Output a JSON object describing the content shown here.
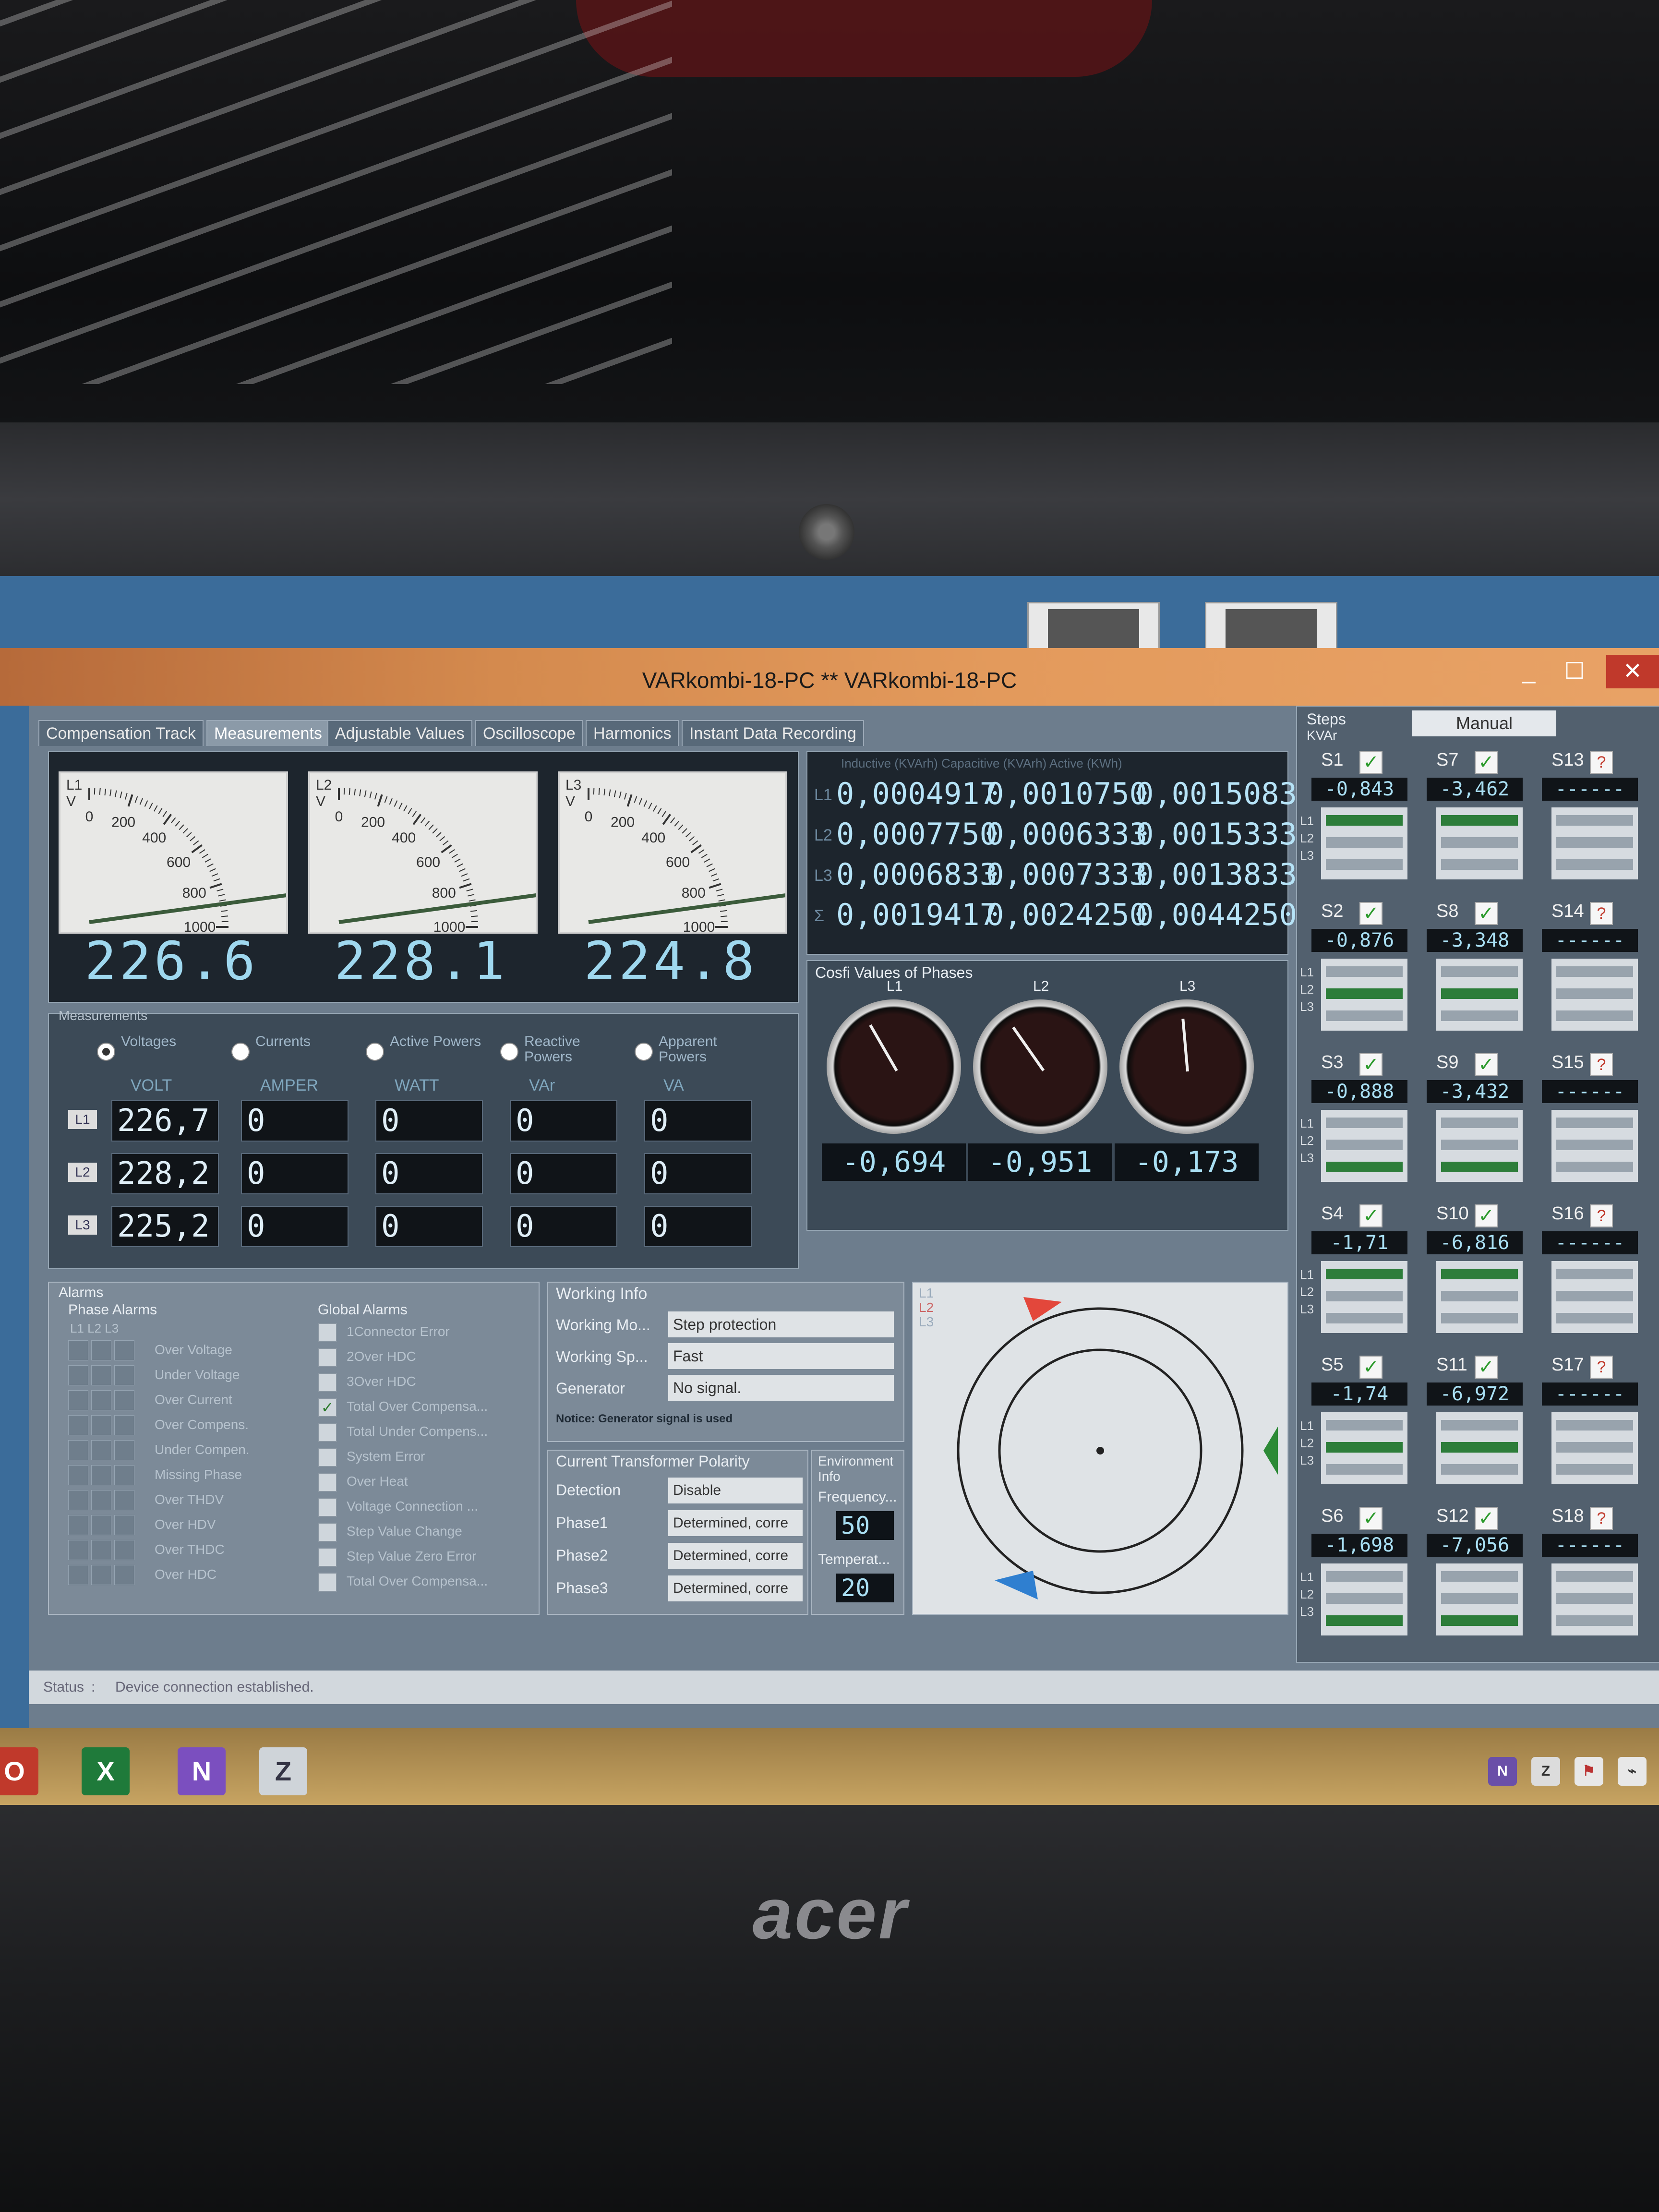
{
  "window": {
    "title": "VARkombi-18-PC ** VARkombi-18-PC",
    "minimize": "_",
    "maximize": "☐",
    "close": "✕"
  },
  "tabs": [
    {
      "label": "Compensation Track"
    },
    {
      "label": "Measurements"
    },
    {
      "label": "Adjustable Values"
    },
    {
      "label": "Oscilloscope"
    },
    {
      "label": "Harmonics"
    },
    {
      "label": "Instant Data Recording"
    }
  ],
  "meters": [
    {
      "phase": "L1",
      "unit": "V",
      "reading": "226.6",
      "ticks": [
        "0",
        "200",
        "400",
        "600",
        "800",
        "1000"
      ]
    },
    {
      "phase": "L2",
      "unit": "V",
      "reading": "228.1",
      "ticks": [
        "0",
        "200",
        "400",
        "600",
        "800",
        "1000"
      ]
    },
    {
      "phase": "L3",
      "unit": "V",
      "reading": "224.8",
      "ticks": [
        "0",
        "200",
        "400",
        "600",
        "800",
        "1000"
      ]
    }
  ],
  "matrix": {
    "header": "Inductive  (KVArh)  Capacitive  (KVArh)  Active (KWh)",
    "row_labels": [
      "L1",
      "L2",
      "L3",
      "Σ"
    ],
    "rows": [
      [
        "0,0004917",
        "0,0010750",
        "0,0015083"
      ],
      [
        "0,0007750",
        "0,0006333",
        "0,0015333"
      ],
      [
        "0,0006833",
        "0,0007333",
        "0,0013833"
      ],
      [
        "0,0019417",
        "0,0024250",
        "0,0044250"
      ]
    ]
  },
  "measurements": {
    "group_label": "Measurements",
    "options": [
      {
        "label": "Voltages",
        "selected": true
      },
      {
        "label": "Currents",
        "selected": false
      },
      {
        "label": "Active Powers",
        "selected": false
      },
      {
        "label": "Reactive Powers",
        "selected": false
      },
      {
        "label": "Apparent Powers",
        "selected": false
      }
    ],
    "columns": [
      "VOLT",
      "AMPER",
      "WATT",
      "VAr",
      "VA"
    ],
    "rows": [
      {
        "label": "L1",
        "values": [
          "226,7",
          "0",
          "0",
          "0",
          "0"
        ]
      },
      {
        "label": "L2",
        "values": [
          "228,2",
          "0",
          "0",
          "0",
          "0"
        ]
      },
      {
        "label": "L3",
        "values": [
          "225,2",
          "0",
          "0",
          "0",
          "0"
        ]
      }
    ]
  },
  "cosfi": {
    "title": "Cosfi Values of Phases",
    "phases": [
      {
        "label": "L1",
        "value": "-0,694"
      },
      {
        "label": "L2",
        "value": "-0,951"
      },
      {
        "label": "L3",
        "value": "-0,173"
      }
    ]
  },
  "steps": {
    "title": "Steps",
    "unit": "KVAr",
    "mode": "Manual",
    "phase_labels": [
      "L1",
      "L2",
      "L3"
    ],
    "cards": [
      {
        "name": "S1",
        "value": "-0,843",
        "checked": true,
        "bars": [
          1,
          0,
          0
        ]
      },
      {
        "name": "S7",
        "value": "-3,462",
        "checked": true,
        "bars": [
          1,
          0,
          0
        ]
      },
      {
        "name": "S13",
        "value": "------",
        "checked": false,
        "bars": [
          0,
          0,
          0
        ]
      },
      {
        "name": "S2",
        "value": "-0,876",
        "checked": true,
        "bars": [
          0,
          1,
          0
        ]
      },
      {
        "name": "S8",
        "value": "-3,348",
        "checked": true,
        "bars": [
          0,
          1,
          0
        ]
      },
      {
        "name": "S14",
        "value": "------",
        "checked": false,
        "bars": [
          0,
          0,
          0
        ]
      },
      {
        "name": "S3",
        "value": "-0,888",
        "checked": true,
        "bars": [
          0,
          0,
          1
        ]
      },
      {
        "name": "S9",
        "value": "-3,432",
        "checked": true,
        "bars": [
          0,
          0,
          1
        ]
      },
      {
        "name": "S15",
        "value": "------",
        "checked": false,
        "bars": [
          0,
          0,
          0
        ]
      },
      {
        "name": "S4",
        "value": "-1,71",
        "checked": true,
        "bars": [
          1,
          0,
          0
        ]
      },
      {
        "name": "S10",
        "value": "-6,816",
        "checked": true,
        "bars": [
          1,
          0,
          0
        ]
      },
      {
        "name": "S16",
        "value": "------",
        "checked": false,
        "bars": [
          0,
          0,
          0
        ]
      },
      {
        "name": "S5",
        "value": "-1,74",
        "checked": true,
        "bars": [
          0,
          1,
          0
        ]
      },
      {
        "name": "S11",
        "value": "-6,972",
        "checked": true,
        "bars": [
          0,
          1,
          0
        ]
      },
      {
        "name": "S17",
        "value": "------",
        "checked": false,
        "bars": [
          0,
          0,
          0
        ]
      },
      {
        "name": "S6",
        "value": "-1,698",
        "checked": true,
        "bars": [
          0,
          0,
          1
        ]
      },
      {
        "name": "S12",
        "value": "-7,056",
        "checked": true,
        "bars": [
          0,
          0,
          1
        ]
      },
      {
        "name": "S18",
        "value": "------",
        "checked": false,
        "bars": [
          0,
          0,
          0
        ]
      }
    ]
  },
  "alarms": {
    "title": "Alarms",
    "phase_title": "Phase Alarms",
    "phase_cols": "L1 L2 L3",
    "phase_items": [
      "Over Voltage",
      "Under Voltage",
      "Over Current",
      "Over Compens.",
      "Under Compen.",
      "Missing Phase",
      "Over THDV",
      "Over HDV",
      "Over THDC",
      "Over HDC"
    ],
    "global_title": "Global Alarms",
    "global_items": [
      {
        "label": "1Connector Error",
        "checked": false
      },
      {
        "label": "2Over HDC",
        "checked": false
      },
      {
        "label": "3Over HDC",
        "checked": false
      },
      {
        "label": "Total Over Compensa...",
        "checked": true
      },
      {
        "label": "Total Under Compens...",
        "checked": false
      },
      {
        "label": "System Error",
        "checked": false
      },
      {
        "label": "Over Heat",
        "checked": false
      },
      {
        "label": "Voltage Connection ...",
        "checked": false
      },
      {
        "label": "Step Value Change",
        "checked": false
      },
      {
        "label": "Step Value Zero Error",
        "checked": false
      },
      {
        "label": "Total Over Compensa...",
        "checked": false
      }
    ]
  },
  "working": {
    "title": "Working Info",
    "rows": [
      {
        "label": "Working Mo...",
        "value": "Step protection"
      },
      {
        "label": "Working Sp...",
        "value": "Fast"
      },
      {
        "label": "Generator",
        "value": "No signal."
      }
    ],
    "notice": "Notice: Generator signal is used"
  },
  "ct": {
    "title": "Current Transformer Polarity",
    "rows": [
      {
        "label": "Detection",
        "value": "Disable"
      },
      {
        "label": "Phase1",
        "value": "Determined, corre"
      },
      {
        "label": "Phase2",
        "value": "Determined, corre"
      },
      {
        "label": "Phase3",
        "value": "Determined, corre"
      }
    ]
  },
  "env": {
    "title": "Environment Info",
    "frequency_label": "Frequency...",
    "frequency": "50",
    "temperature_label": "Temperat...",
    "temperature": "20"
  },
  "phasor": {
    "labels": [
      "L1",
      "L2",
      "L3"
    ]
  },
  "status": {
    "label": "Status",
    "text": "Device connection established."
  },
  "brand": "acer",
  "colors": {
    "accent_green": "#2d7d3a",
    "title_orange": "#e39a5c",
    "lcd_cyan": "#a9dff3",
    "alarm_red": "#c0392b"
  }
}
